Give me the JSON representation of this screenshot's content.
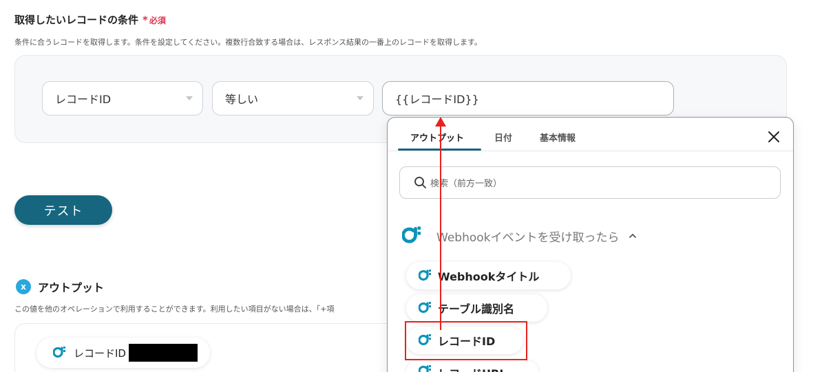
{
  "condition": {
    "title": "取得したいレコードの条件",
    "required_mark": "*",
    "required_text": "必須",
    "description": "条件に合うレコードを取得します。条件を設定してください。複数行合致する場合は、レスポンス結果の一番上のレコードを取得します。",
    "field_select": "レコードID",
    "operator_select": "等しい",
    "value": "{{レコードID}}"
  },
  "test_button": "テスト",
  "output": {
    "title": "アウトプット",
    "icon_glyph": "x",
    "description": "この値を他のオペレーションで利用することができます。利用したい項目がない場合は、「+項",
    "chip_label": "レコードID"
  },
  "popup": {
    "tabs": [
      "アウトプット",
      "日付",
      "基本情報"
    ],
    "active_tab": 0,
    "search_placeholder": "検索（前方一致）",
    "group_label": "Webhookイベントを受け取ったら",
    "items": [
      "Webhookタイトル",
      "テーブル識別名",
      "レコードID",
      "レコードURL"
    ],
    "highlighted_item": "レコードID"
  },
  "colors": {
    "accent": "#16667f",
    "required": "#e0334f",
    "annotation_red": "#e8211c",
    "brand_icon": "#0c93b8"
  }
}
